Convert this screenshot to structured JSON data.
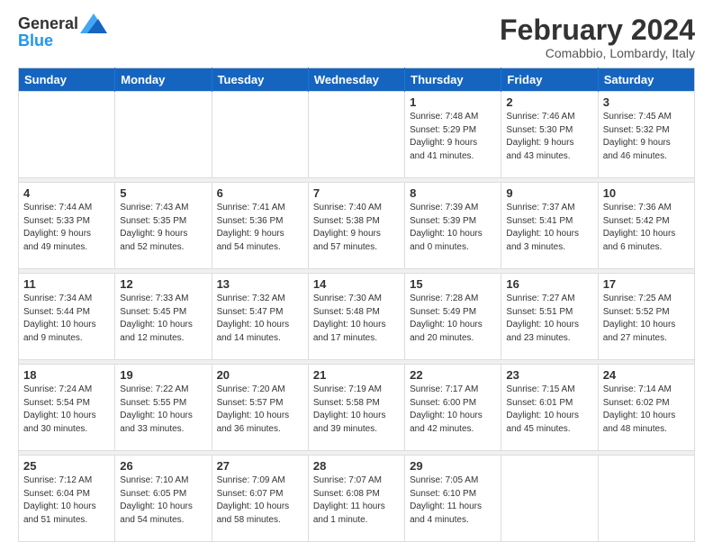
{
  "header": {
    "logo_line1": "General",
    "logo_line2": "Blue",
    "month": "February 2024",
    "location": "Comabbio, Lombardy, Italy"
  },
  "weekdays": [
    "Sunday",
    "Monday",
    "Tuesday",
    "Wednesday",
    "Thursday",
    "Friday",
    "Saturday"
  ],
  "weeks": [
    [
      {
        "day": "",
        "info": ""
      },
      {
        "day": "",
        "info": ""
      },
      {
        "day": "",
        "info": ""
      },
      {
        "day": "",
        "info": ""
      },
      {
        "day": "1",
        "info": "Sunrise: 7:48 AM\nSunset: 5:29 PM\nDaylight: 9 hours\nand 41 minutes."
      },
      {
        "day": "2",
        "info": "Sunrise: 7:46 AM\nSunset: 5:30 PM\nDaylight: 9 hours\nand 43 minutes."
      },
      {
        "day": "3",
        "info": "Sunrise: 7:45 AM\nSunset: 5:32 PM\nDaylight: 9 hours\nand 46 minutes."
      }
    ],
    [
      {
        "day": "4",
        "info": "Sunrise: 7:44 AM\nSunset: 5:33 PM\nDaylight: 9 hours\nand 49 minutes."
      },
      {
        "day": "5",
        "info": "Sunrise: 7:43 AM\nSunset: 5:35 PM\nDaylight: 9 hours\nand 52 minutes."
      },
      {
        "day": "6",
        "info": "Sunrise: 7:41 AM\nSunset: 5:36 PM\nDaylight: 9 hours\nand 54 minutes."
      },
      {
        "day": "7",
        "info": "Sunrise: 7:40 AM\nSunset: 5:38 PM\nDaylight: 9 hours\nand 57 minutes."
      },
      {
        "day": "8",
        "info": "Sunrise: 7:39 AM\nSunset: 5:39 PM\nDaylight: 10 hours\nand 0 minutes."
      },
      {
        "day": "9",
        "info": "Sunrise: 7:37 AM\nSunset: 5:41 PM\nDaylight: 10 hours\nand 3 minutes."
      },
      {
        "day": "10",
        "info": "Sunrise: 7:36 AM\nSunset: 5:42 PM\nDaylight: 10 hours\nand 6 minutes."
      }
    ],
    [
      {
        "day": "11",
        "info": "Sunrise: 7:34 AM\nSunset: 5:44 PM\nDaylight: 10 hours\nand 9 minutes."
      },
      {
        "day": "12",
        "info": "Sunrise: 7:33 AM\nSunset: 5:45 PM\nDaylight: 10 hours\nand 12 minutes."
      },
      {
        "day": "13",
        "info": "Sunrise: 7:32 AM\nSunset: 5:47 PM\nDaylight: 10 hours\nand 14 minutes."
      },
      {
        "day": "14",
        "info": "Sunrise: 7:30 AM\nSunset: 5:48 PM\nDaylight: 10 hours\nand 17 minutes."
      },
      {
        "day": "15",
        "info": "Sunrise: 7:28 AM\nSunset: 5:49 PM\nDaylight: 10 hours\nand 20 minutes."
      },
      {
        "day": "16",
        "info": "Sunrise: 7:27 AM\nSunset: 5:51 PM\nDaylight: 10 hours\nand 23 minutes."
      },
      {
        "day": "17",
        "info": "Sunrise: 7:25 AM\nSunset: 5:52 PM\nDaylight: 10 hours\nand 27 minutes."
      }
    ],
    [
      {
        "day": "18",
        "info": "Sunrise: 7:24 AM\nSunset: 5:54 PM\nDaylight: 10 hours\nand 30 minutes."
      },
      {
        "day": "19",
        "info": "Sunrise: 7:22 AM\nSunset: 5:55 PM\nDaylight: 10 hours\nand 33 minutes."
      },
      {
        "day": "20",
        "info": "Sunrise: 7:20 AM\nSunset: 5:57 PM\nDaylight: 10 hours\nand 36 minutes."
      },
      {
        "day": "21",
        "info": "Sunrise: 7:19 AM\nSunset: 5:58 PM\nDaylight: 10 hours\nand 39 minutes."
      },
      {
        "day": "22",
        "info": "Sunrise: 7:17 AM\nSunset: 6:00 PM\nDaylight: 10 hours\nand 42 minutes."
      },
      {
        "day": "23",
        "info": "Sunrise: 7:15 AM\nSunset: 6:01 PM\nDaylight: 10 hours\nand 45 minutes."
      },
      {
        "day": "24",
        "info": "Sunrise: 7:14 AM\nSunset: 6:02 PM\nDaylight: 10 hours\nand 48 minutes."
      }
    ],
    [
      {
        "day": "25",
        "info": "Sunrise: 7:12 AM\nSunset: 6:04 PM\nDaylight: 10 hours\nand 51 minutes."
      },
      {
        "day": "26",
        "info": "Sunrise: 7:10 AM\nSunset: 6:05 PM\nDaylight: 10 hours\nand 54 minutes."
      },
      {
        "day": "27",
        "info": "Sunrise: 7:09 AM\nSunset: 6:07 PM\nDaylight: 10 hours\nand 58 minutes."
      },
      {
        "day": "28",
        "info": "Sunrise: 7:07 AM\nSunset: 6:08 PM\nDaylight: 11 hours\nand 1 minute."
      },
      {
        "day": "29",
        "info": "Sunrise: 7:05 AM\nSunset: 6:10 PM\nDaylight: 11 hours\nand 4 minutes."
      },
      {
        "day": "",
        "info": ""
      },
      {
        "day": "",
        "info": ""
      }
    ]
  ]
}
